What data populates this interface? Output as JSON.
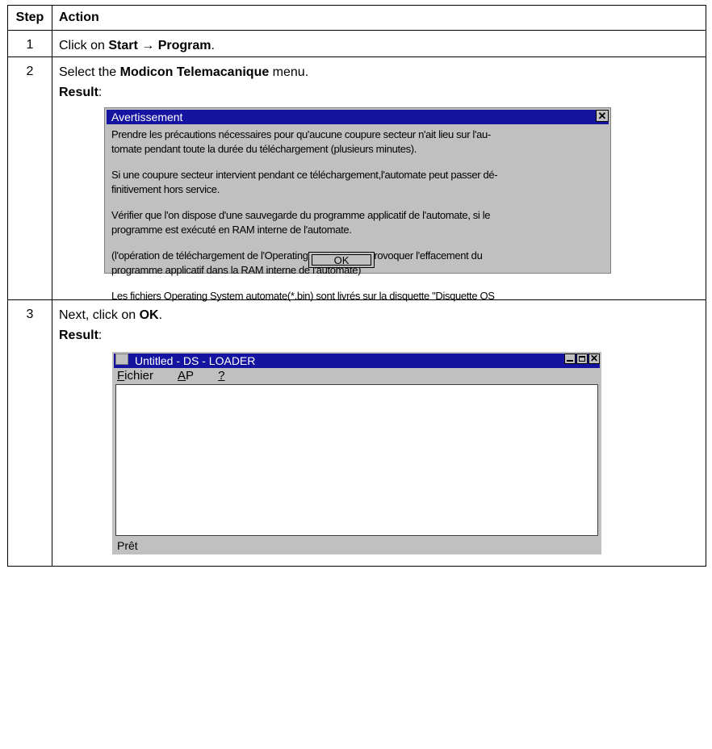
{
  "table": {
    "header_step": "Step",
    "header_action": "Action"
  },
  "steps": [
    {
      "number": "1",
      "text_before": "Click on ",
      "bold1": "Start",
      "arrow": "→",
      "bold2": "Program",
      "text_after": "."
    },
    {
      "number": "2",
      "text_before": "Select the ",
      "bold": "Modicon Telemacanique",
      "text_after": " menu.",
      "result_label": "Result",
      "colon": ":"
    },
    {
      "number": "3",
      "text_before": "Next, click on ",
      "bold": "OK",
      "text_after": ".",
      "result_label": "Result",
      "colon": ":"
    }
  ],
  "dialog": {
    "title": "Avertissement",
    "close_glyph": "✕",
    "p1_l1": "Prendre les précautions nécessaires pour qu'aucune coupure secteur n'ait lieu sur l'au-",
    "p1_l2": "tomate pendant toute la durée du téléchargement (plusieurs minutes).",
    "p2_l1": "Si une coupure secteur intervient pendant ce téléchargement,l'automate peut passer dé-",
    "p2_l2": "finitivement hors service.",
    "p3_l1": "Vérifier que l'on dispose d'une sauvegarde du programme applicatif de l'automate, si le",
    "p3_l2": "programme est exécuté en RAM interne de l'automate.",
    "p4_l1": "(l'opération de téléchargement de l'Operating System peut provoquer l'effacement du",
    "p4_l2": "programme applicatif dans la RAM interne de l'automate)",
    "p5_l1": "Les fichiers Operating System automate(*.bin) sont livrés sur la disquette \"Disquette OS",
    "ok_label": "OK"
  },
  "window": {
    "title": "Untitled - DS - LOADER",
    "close_glyph": "✕",
    "menu": [
      {
        "mnemonic": "F",
        "rest": "ichier"
      },
      {
        "mnemonic": "A",
        "rest": "P"
      },
      {
        "mnemonic": "?",
        "rest": ""
      }
    ],
    "status": "Prêt"
  }
}
